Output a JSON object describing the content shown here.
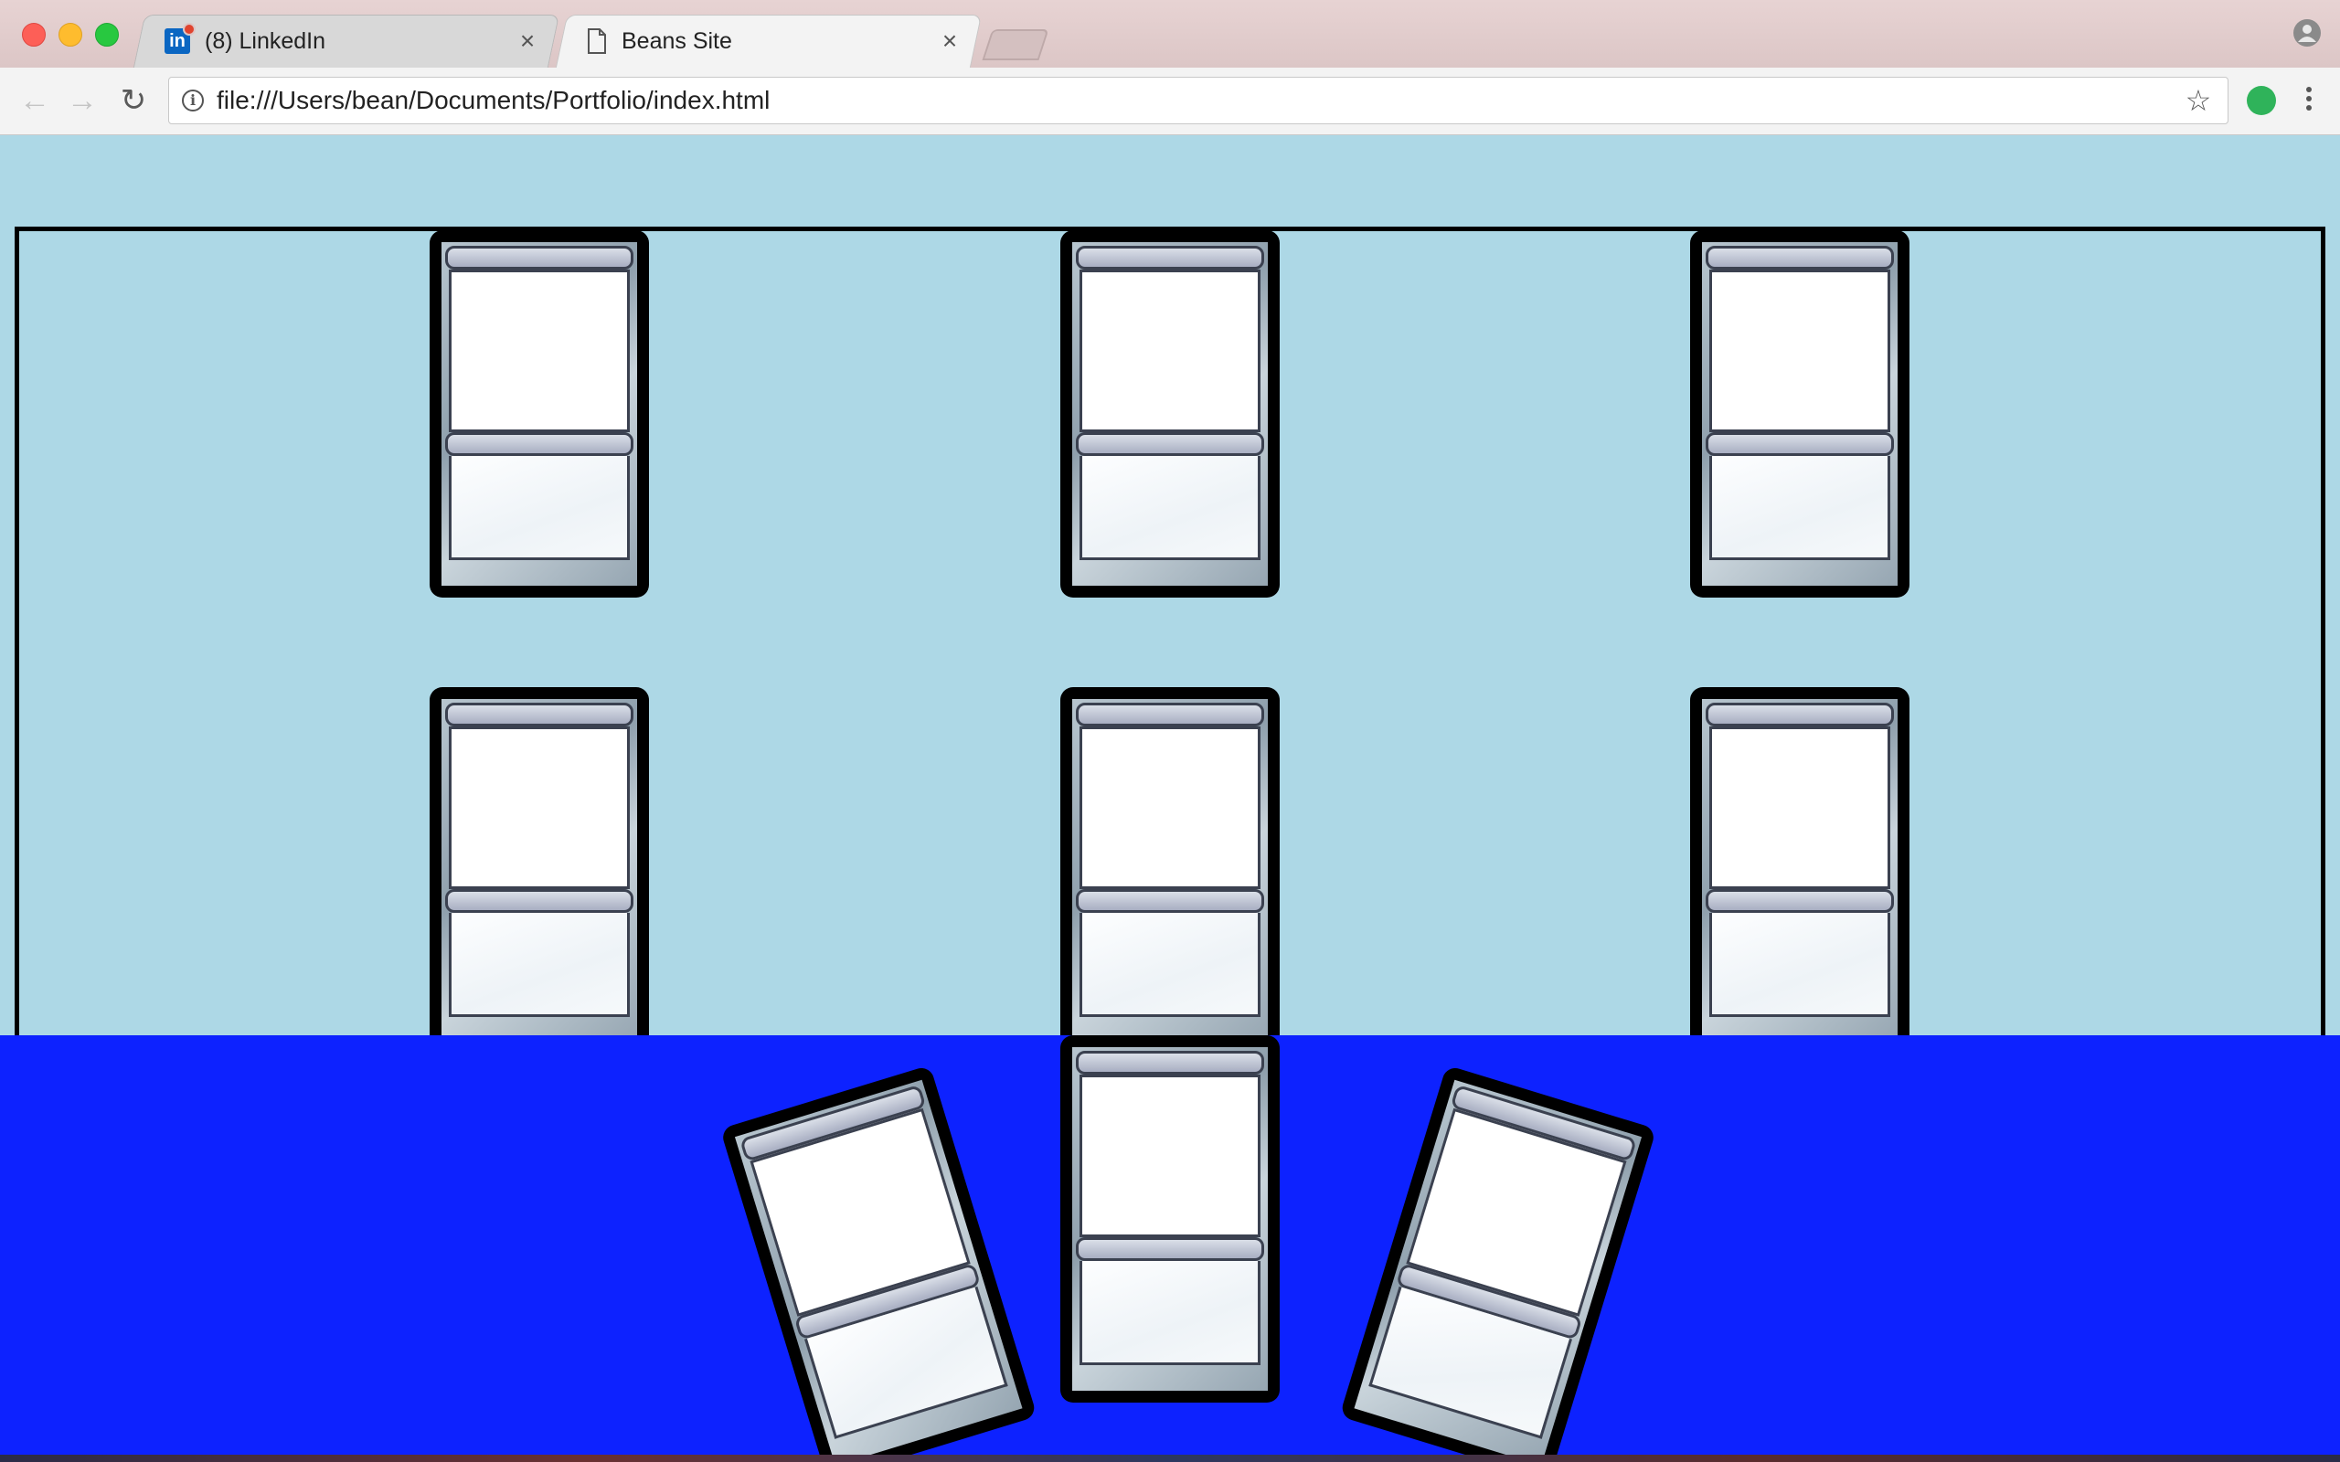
{
  "browser": {
    "tabs": [
      {
        "title": "(8) LinkedIn",
        "icon": "linkedin-icon",
        "active": false,
        "close": "×"
      },
      {
        "title": "Beans Site",
        "icon": "document-icon",
        "active": true,
        "close": "×"
      }
    ],
    "address": {
      "url": "file:///Users/bean/Documents/Portfolio/index.html"
    },
    "nav": {
      "back": "←",
      "forward": "→",
      "reload": "↻",
      "star": "☆"
    }
  },
  "page": {
    "background": "#add8e6",
    "hand_background": "#0d22ff",
    "board_cards": 6,
    "hand_cards": 3
  }
}
